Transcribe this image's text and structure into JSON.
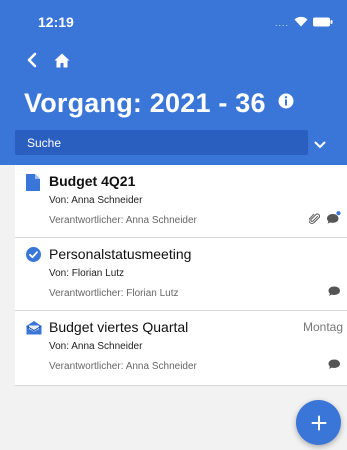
{
  "status_bar": {
    "time": "12:19",
    "signal": "....",
    "wifi_icon": "wifi-icon",
    "battery_icon": "battery-icon"
  },
  "nav": {
    "back_icon": "chevron-left-icon",
    "home_icon": "home-icon"
  },
  "header": {
    "title": "Vorgang: 2021 - 36",
    "info_icon": "info-icon"
  },
  "search": {
    "placeholder": "Suche",
    "chevron_icon": "chevron-down-icon"
  },
  "colors": {
    "brand": "#3a75d8",
    "search_bg": "#2a5fc0",
    "check": "#3a75d8"
  },
  "items": [
    {
      "title": "Budget 4Q21",
      "from": "Von: Anna Schneider",
      "responsible": "Verantwortlicher: Anna Schneider",
      "date": "",
      "icon": "document-icon",
      "meta_icons": [
        "paperclip-icon",
        "comment-unread-icon"
      ]
    },
    {
      "title": "Personalstatusmeeting",
      "from": "Von: Florian Lutz",
      "responsible": "Verantwortlicher: Florian Lutz",
      "date": "",
      "icon": "check-circle-icon",
      "meta_icons": [
        "comment-icon"
      ]
    },
    {
      "title": "Budget viertes Quartal",
      "from": "Von: Anna Schneider",
      "responsible": "Verantwortlicher: Anna Schneider",
      "date": "Montag",
      "icon": "open-envelope-icon",
      "meta_icons": [
        "comment-icon"
      ]
    }
  ],
  "fab": {
    "icon": "plus-icon"
  }
}
